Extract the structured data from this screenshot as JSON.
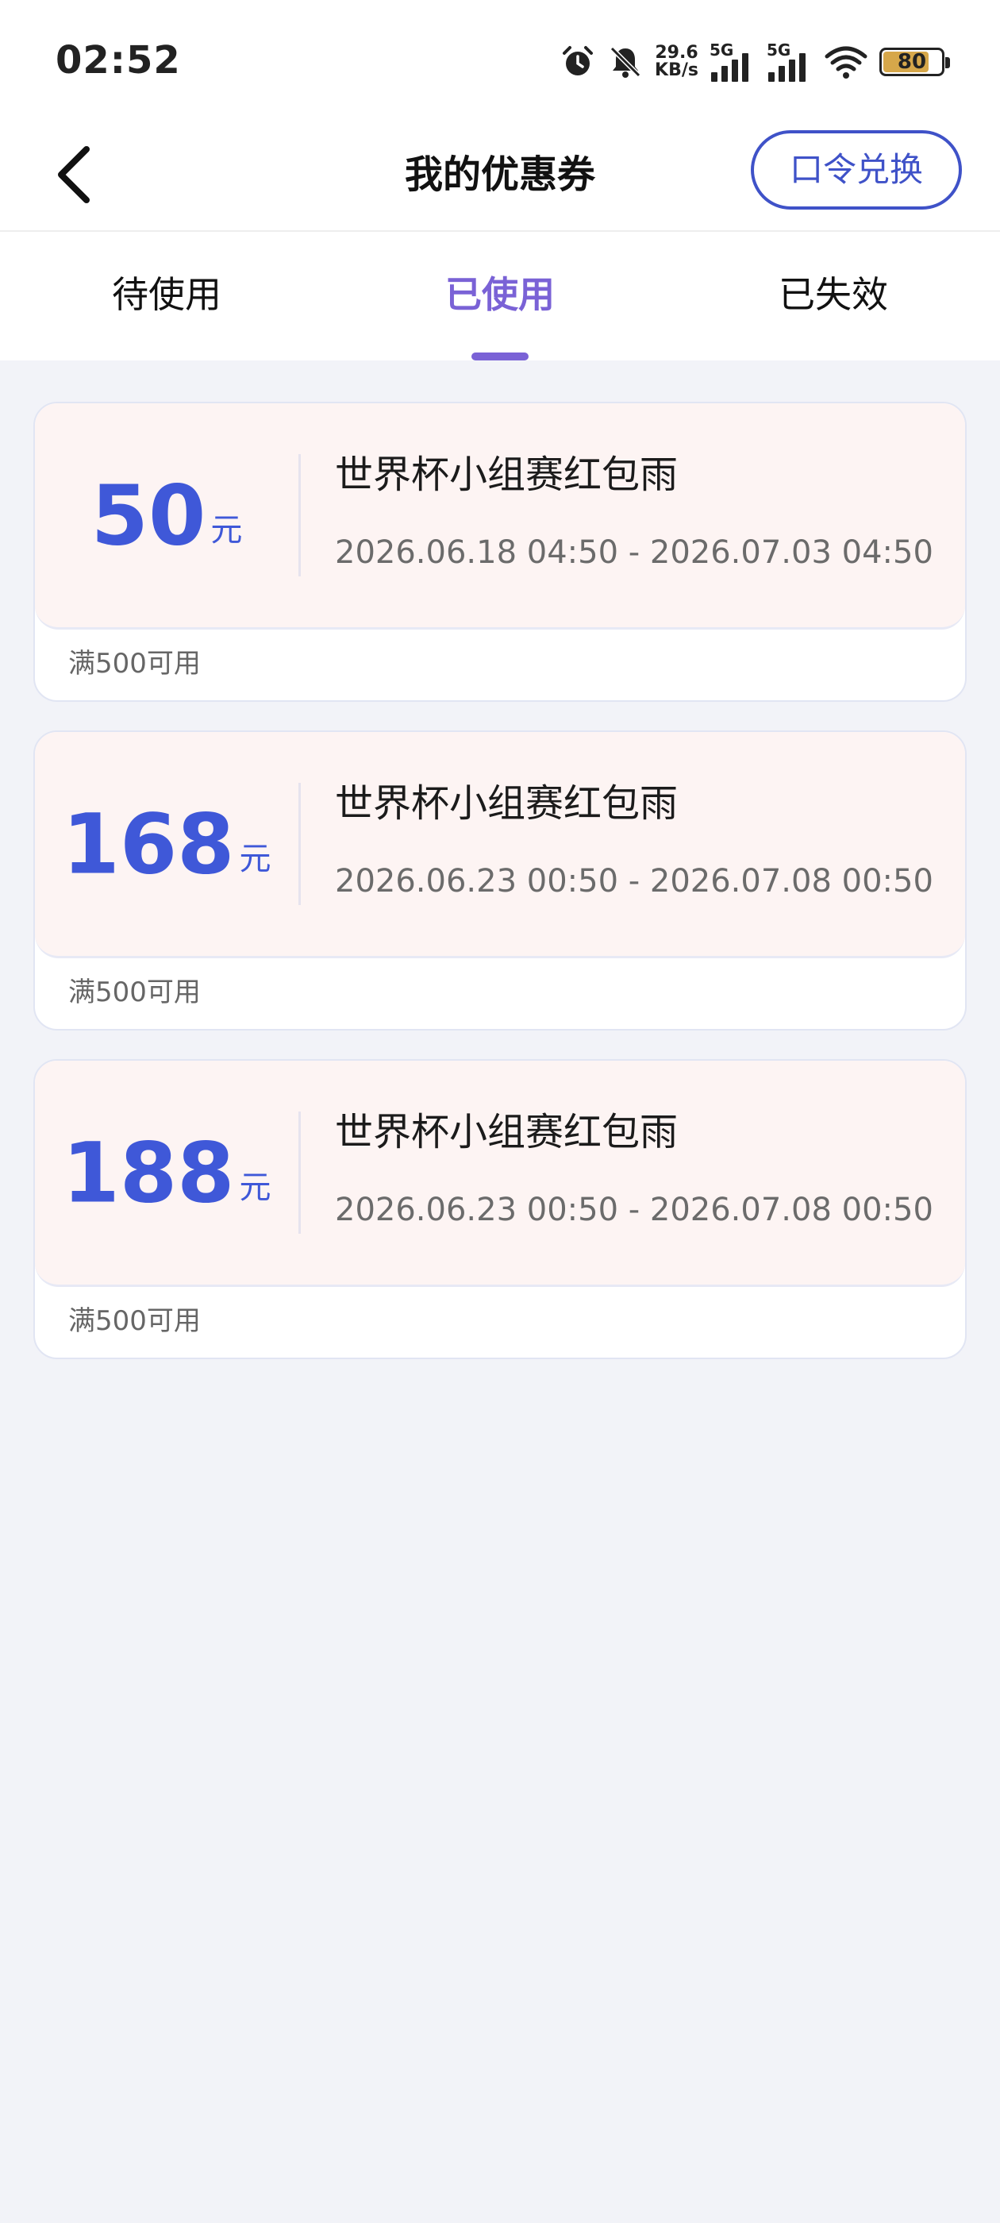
{
  "status_bar": {
    "time": "02:52",
    "net_speed_value": "29.6",
    "net_speed_unit": "KB/s",
    "sim1_label": "5G",
    "sim2_label": "5G",
    "battery_level": "80",
    "battery_fraction": 0.8,
    "icons": [
      "alarm-icon",
      "bell-muted-icon",
      "signal-icon",
      "signal-icon",
      "wifi-icon",
      "battery-icon"
    ]
  },
  "header": {
    "back_icon": "chevron-left-icon",
    "title": "我的优惠券",
    "redeem_label": "口令兑换"
  },
  "tabs": [
    {
      "label": "待使用",
      "active": false
    },
    {
      "label": "已使用",
      "active": true
    },
    {
      "label": "已失效",
      "active": false
    }
  ],
  "coupons": [
    {
      "amount": "50",
      "unit": "元",
      "title": "世界杯小组赛红包雨",
      "date_range": "2026.06.18 04:50 - 2026.07.03 04:50",
      "condition": "满500可用"
    },
    {
      "amount": "168",
      "unit": "元",
      "title": "世界杯小组赛红包雨",
      "date_range": "2026.06.23 00:50 - 2026.07.08 00:50",
      "condition": "满500可用"
    },
    {
      "amount": "188",
      "unit": "元",
      "title": "世界杯小组赛红包雨",
      "date_range": "2026.06.23 00:50 - 2026.07.08 00:50",
      "condition": "满500可用"
    }
  ],
  "colors": {
    "accent_blue": "#3f58d8",
    "tab_active": "#7a62d6",
    "page_bg": "#f2f3f8",
    "coupon_top_bg": "#fdf4f3"
  }
}
